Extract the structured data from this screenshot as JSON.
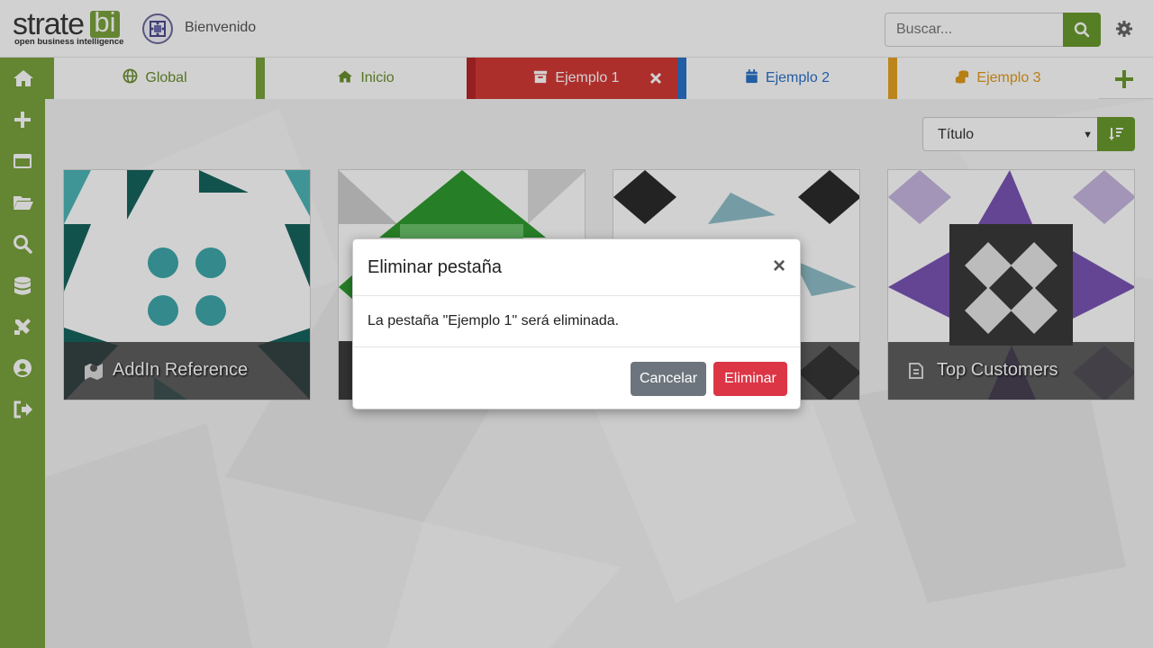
{
  "header": {
    "logo_text": "strate",
    "logo_accent": "bi",
    "logo_tagline": "open business intelligence",
    "welcome": "Bienvenido",
    "search_placeholder": "Buscar..."
  },
  "sidebar": {
    "items": [
      {
        "icon": "home-icon"
      },
      {
        "icon": "plus-icon"
      },
      {
        "icon": "window-icon"
      },
      {
        "icon": "folder-open-icon"
      },
      {
        "icon": "search-icon"
      },
      {
        "icon": "database-icon"
      },
      {
        "icon": "tools-icon"
      },
      {
        "icon": "user-circle-icon"
      },
      {
        "icon": "sign-out-icon"
      }
    ]
  },
  "tabs": [
    {
      "label": "Global",
      "icon": "globe-icon",
      "color": "#6a8f2e",
      "active": false
    },
    {
      "label": "Inicio",
      "icon": "home-icon",
      "color": "#6a8f2e",
      "active": false
    },
    {
      "label": "Ejemplo 1",
      "icon": "archive-icon",
      "color": "#d0312d",
      "active": true
    },
    {
      "label": "Ejemplo 2",
      "icon": "calendar-icon",
      "color": "#2b72c9",
      "active": false
    },
    {
      "label": "Ejemplo 3",
      "icon": "coins-icon",
      "color": "#e09b1a",
      "active": false
    }
  ],
  "sort": {
    "selected": "Título"
  },
  "cards": [
    {
      "title": "AddIn Reference",
      "icon": "map-marker-icon"
    },
    {
      "title": "",
      "icon": ""
    },
    {
      "title": "",
      "icon": ""
    },
    {
      "title": "Top Customers",
      "icon": "report-icon"
    }
  ],
  "modal": {
    "title": "Eliminar pestaña",
    "close": "×",
    "message": "La pestaña \"Ejemplo 1\" será eliminada.",
    "cancel_label": "Cancelar",
    "delete_label": "Eliminar"
  },
  "colors": {
    "brand_green": "#7aa33d",
    "danger": "#dc3545",
    "secondary": "#6c757d"
  }
}
